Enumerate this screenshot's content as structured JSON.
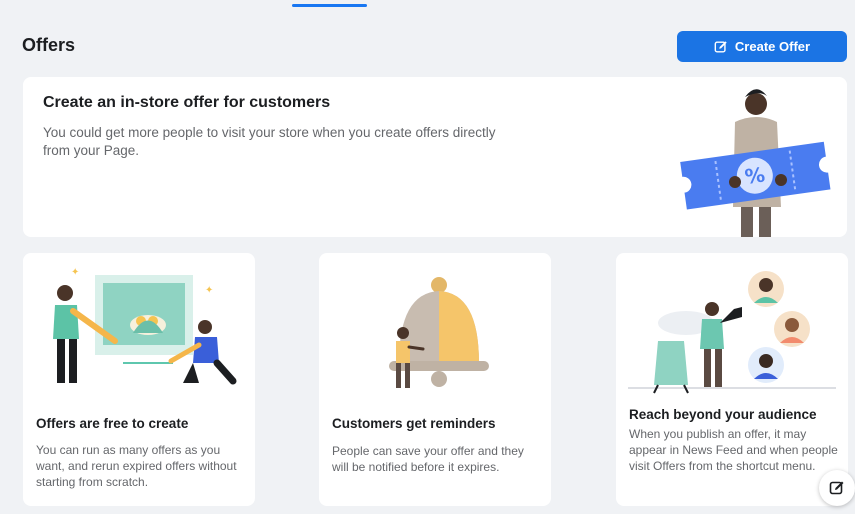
{
  "header": {
    "title": "Offers",
    "create_button_label": "Create Offer",
    "create_button_icon": "edit-icon"
  },
  "hero": {
    "title": "Create an in-store offer for customers",
    "description": "You could get more people to visit your store when you create offers directly from your Page."
  },
  "cards": [
    {
      "title": "Offers are free to create",
      "description": "You can run as many offers as you want, and rerun expired offers without starting from scratch."
    },
    {
      "title": "Customers get reminders",
      "description": "People can save your offer and they will be notified before it expires."
    },
    {
      "title": "Reach beyond your audience",
      "description": "When you publish an offer, it may appear in News Feed and when people visit Offers from the shortcut menu."
    }
  ],
  "floating_button": {
    "icon": "compose-icon"
  },
  "colors": {
    "accent": "#1b74e4",
    "background": "#f0f2f5"
  }
}
